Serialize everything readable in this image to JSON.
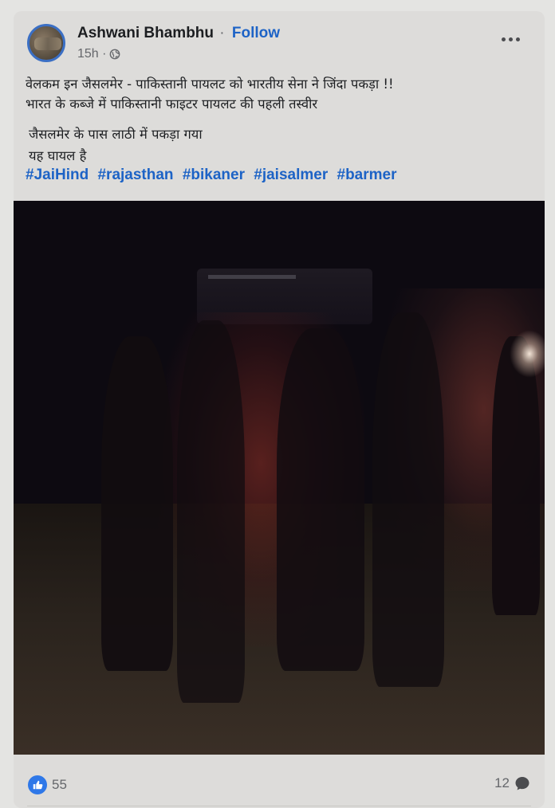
{
  "post": {
    "author": "Ashwani Bhambhu",
    "separator": "·",
    "follow_label": "Follow",
    "time": "15h ·",
    "privacy_icon": "globe-icon",
    "more_icon": "more-options-icon",
    "text_lines": [
      "वेलकम इन जैसलमेर - पाकिस्तानी पायलट को भारतीय सेना ने जिंदा पकड़ा !!",
      "भारत के कब्जे में पाकिस्तानी फाइटर पायलट की पहली तस्वीर"
    ],
    "paragraph2": [
      "जैसलमेर के पास लाठी में पकड़ा गया",
      "यह घायल है"
    ],
    "hashtags": [
      "#JaiHind",
      "#rajasthan",
      "#bikaner",
      "#jaisalmer",
      "#barmer"
    ],
    "link_color": "#1d63c6"
  },
  "reactions": {
    "like_icon": "like-thumb-icon",
    "like_count": "55",
    "comment_count": "12",
    "comment_icon": "comment-bubble-icon",
    "accent": "#2f78e8"
  }
}
